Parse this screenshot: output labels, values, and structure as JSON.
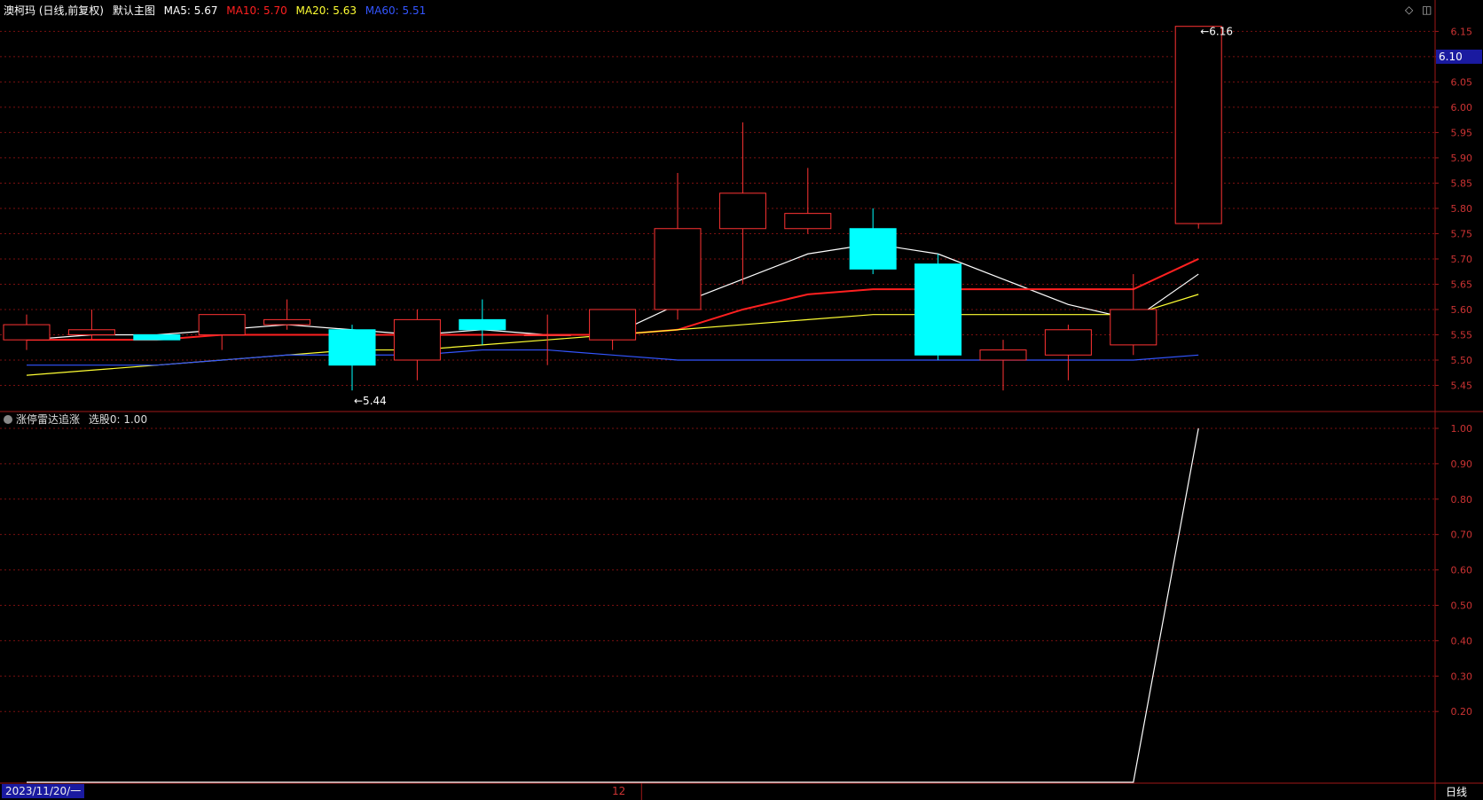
{
  "header": {
    "stock_label": "澳柯玛 (日线,前复权)",
    "chart_label": "默认主图",
    "ma5": {
      "label": "MA5:",
      "value": "5.67",
      "color": "#ffffff"
    },
    "ma10": {
      "label": "MA10:",
      "value": "5.70",
      "color": "#ff2020"
    },
    "ma20": {
      "label": "MA20:",
      "value": "5.63",
      "color": "#ffff33"
    },
    "ma60": {
      "label": "MA60:",
      "value": "5.51",
      "color": "#3355ff"
    },
    "menu_icon": "diamond-icon",
    "collapse_icon": "collapse-icon"
  },
  "sub_header": {
    "indicator_label": "涨停雷达追涨",
    "signal_label": "选股0:",
    "signal_value": "1.00",
    "collapse_icon": "chevron-down-icon"
  },
  "colors": {
    "up": "#ff3333",
    "down": "#00ffff",
    "grid": "#7a1010",
    "axis": "#a01818",
    "axis_text": "#cc3333",
    "price_tag_bg": "#1a1aa0",
    "date_tag_bg": "#1a1aa0"
  },
  "chart_data": [
    {
      "type": "candlestick",
      "ylim": [
        5.4,
        6.17
      ],
      "yticks": [
        5.45,
        5.5,
        5.55,
        5.6,
        5.65,
        5.7,
        5.75,
        5.8,
        5.85,
        5.9,
        5.95,
        6.0,
        6.05,
        6.1,
        6.15
      ],
      "candles": [
        {
          "open": 5.54,
          "close": 5.57,
          "high": 5.59,
          "low": 5.52
        },
        {
          "open": 5.55,
          "close": 5.56,
          "high": 5.6,
          "low": 5.54
        },
        {
          "open": 5.55,
          "close": 5.54,
          "high": 5.55,
          "low": 5.54
        },
        {
          "open": 5.55,
          "close": 5.59,
          "high": 5.59,
          "low": 5.52
        },
        {
          "open": 5.57,
          "close": 5.58,
          "high": 5.62,
          "low": 5.56
        },
        {
          "open": 5.56,
          "close": 5.49,
          "high": 5.57,
          "low": 5.44
        },
        {
          "open": 5.5,
          "close": 5.58,
          "high": 5.6,
          "low": 5.46
        },
        {
          "open": 5.58,
          "close": 5.56,
          "high": 5.62,
          "low": 5.53
        },
        {
          "open": 5.55,
          "close": 5.55,
          "high": 5.59,
          "low": 5.49
        },
        {
          "open": 5.54,
          "close": 5.6,
          "high": 5.6,
          "low": 5.52
        },
        {
          "open": 5.6,
          "close": 5.76,
          "high": 5.87,
          "low": 5.58
        },
        {
          "open": 5.76,
          "close": 5.83,
          "high": 5.97,
          "low": 5.65
        },
        {
          "open": 5.76,
          "close": 5.79,
          "high": 5.88,
          "low": 5.75
        },
        {
          "open": 5.76,
          "close": 5.68,
          "high": 5.8,
          "low": 5.67
        },
        {
          "open": 5.69,
          "close": 5.51,
          "high": 5.71,
          "low": 5.5
        },
        {
          "open": 5.5,
          "close": 5.52,
          "high": 5.54,
          "low": 5.44
        },
        {
          "open": 5.51,
          "close": 5.56,
          "high": 5.57,
          "low": 5.46
        },
        {
          "open": 5.53,
          "close": 5.6,
          "high": 5.67,
          "low": 5.51
        },
        {
          "open": 5.77,
          "close": 6.16,
          "high": 6.16,
          "low": 5.76
        }
      ],
      "series": [
        {
          "name": "MA5",
          "color": "#ffffff",
          "values": [
            5.54,
            5.55,
            5.55,
            5.56,
            5.57,
            5.56,
            5.55,
            5.56,
            5.55,
            5.55,
            5.61,
            5.66,
            5.71,
            5.73,
            5.71,
            5.66,
            5.61,
            5.58,
            5.67
          ]
        },
        {
          "name": "MA10",
          "color": "#ff2020",
          "values": [
            5.54,
            5.54,
            5.54,
            5.55,
            5.55,
            5.55,
            5.55,
            5.55,
            5.55,
            5.55,
            5.56,
            5.6,
            5.63,
            5.64,
            5.64,
            5.64,
            5.64,
            5.64,
            5.7
          ]
        },
        {
          "name": "MA20",
          "color": "#ffff33",
          "values": [
            5.47,
            5.48,
            5.49,
            5.5,
            5.51,
            5.52,
            5.52,
            5.53,
            5.54,
            5.55,
            5.56,
            5.57,
            5.58,
            5.59,
            5.59,
            5.59,
            5.59,
            5.59,
            5.63
          ]
        },
        {
          "name": "MA60",
          "color": "#3355ff",
          "values": [
            5.49,
            5.49,
            5.49,
            5.5,
            5.51,
            5.51,
            5.51,
            5.52,
            5.52,
            5.51,
            5.5,
            5.5,
            5.5,
            5.5,
            5.5,
            5.5,
            5.5,
            5.5,
            5.51
          ]
        }
      ],
      "annotations": [
        {
          "label": "5.44",
          "candle": 5,
          "value": 5.44
        },
        {
          "label": "6.16",
          "candle": 18,
          "value": 6.16
        }
      ],
      "last_price": "6.10",
      "last_price_value": 6.1
    },
    {
      "type": "line",
      "ylim": [
        0.0,
        1.03
      ],
      "yticks": [
        0.2,
        0.3,
        0.4,
        0.5,
        0.6,
        0.7,
        0.8,
        0.9,
        1.0
      ],
      "series": [
        {
          "name": "选股0",
          "color": "#ffffff",
          "values": [
            0,
            0,
            0,
            0,
            0,
            0,
            0,
            0,
            0,
            0,
            0,
            0,
            0,
            0,
            0,
            0,
            0,
            0,
            1.0
          ]
        }
      ]
    }
  ],
  "x_axis": {
    "date_label": "2023/11/20/一",
    "month_marker": "12",
    "month_marker_candle": 9,
    "period_label": "日线"
  }
}
